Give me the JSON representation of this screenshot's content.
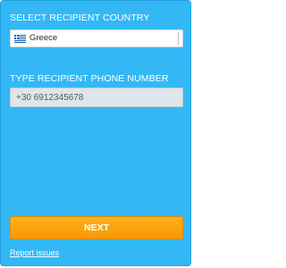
{
  "country_section": {
    "label": "SELECT RECIPIENT COUNTRY",
    "selected_country": "Greece",
    "flag_icon": "greece-flag-icon"
  },
  "phone_section": {
    "label": "TYPE RECIPIENT PHONE NUMBER",
    "value": "+30 6912345678"
  },
  "actions": {
    "next_label": "NEXT",
    "report_label": "Report issues"
  },
  "colors": {
    "panel_background": "#34b8f5",
    "button_orange": "#f7a30f"
  }
}
